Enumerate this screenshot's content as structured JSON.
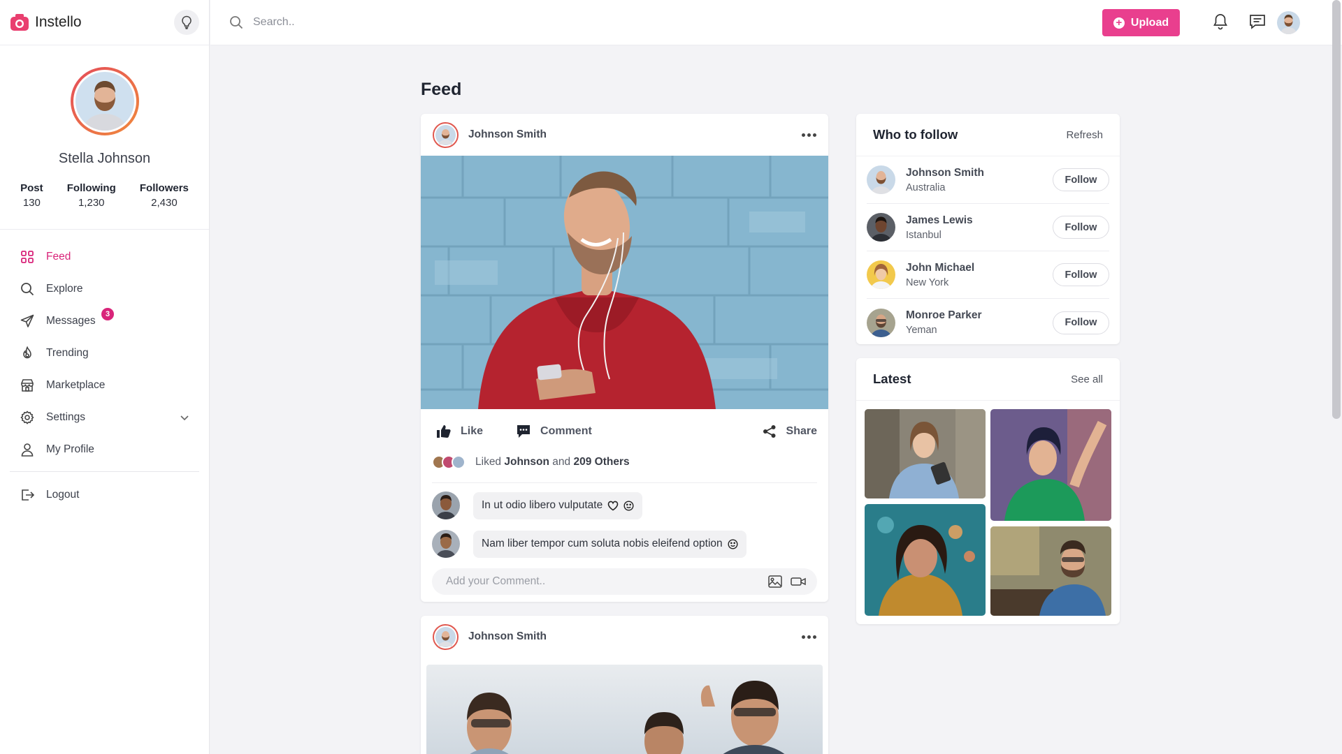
{
  "brand": {
    "name": "Instello"
  },
  "profile": {
    "name": "Stella Johnson",
    "stats": [
      {
        "label": "Post",
        "value": "130"
      },
      {
        "label": "Following",
        "value": "1,230"
      },
      {
        "label": "Followers",
        "value": "2,430"
      }
    ]
  },
  "nav": {
    "items": [
      {
        "label": "Feed",
        "icon": "grid-icon",
        "active": true
      },
      {
        "label": "Explore",
        "icon": "search-icon"
      },
      {
        "label": "Messages",
        "icon": "send-icon",
        "badge": "3"
      },
      {
        "label": "Trending",
        "icon": "fire-icon"
      },
      {
        "label": "Marketplace",
        "icon": "store-icon"
      },
      {
        "label": "Settings",
        "icon": "gear-icon"
      },
      {
        "label": "My Profile",
        "icon": "user-icon"
      }
    ],
    "logout": "Logout"
  },
  "topbar": {
    "search_placeholder": "Search..",
    "upload_label": "Upload"
  },
  "colors": {
    "accent": "#e93f8e",
    "active_nav": "#d9247a"
  },
  "main": {
    "title": "Feed",
    "posts": [
      {
        "author": "Johnson Smith",
        "actions": {
          "like": "Like",
          "comment": "Comment",
          "share": "Share"
        },
        "liked": {
          "prefix": "Liked",
          "name": "Johnson",
          "and": "and",
          "others": "209 Others"
        },
        "comments": [
          {
            "text": "In ut odio libero vulputate"
          },
          {
            "text": "Nam liber tempor cum soluta nobis eleifend option"
          }
        ],
        "comment_placeholder": "Add your Comment.."
      },
      {
        "author": "Johnson Smith"
      }
    ]
  },
  "who_to_follow": {
    "title": "Who to follow",
    "refresh": "Refresh",
    "follow_label": "Follow",
    "people": [
      {
        "name": "Johnson Smith",
        "location": "Australia"
      },
      {
        "name": "James Lewis",
        "location": "Istanbul"
      },
      {
        "name": "John Michael",
        "location": "New York"
      },
      {
        "name": "Monroe Parker",
        "location": "Yeman"
      }
    ]
  },
  "latest": {
    "title": "Latest",
    "see_all": "See all"
  }
}
